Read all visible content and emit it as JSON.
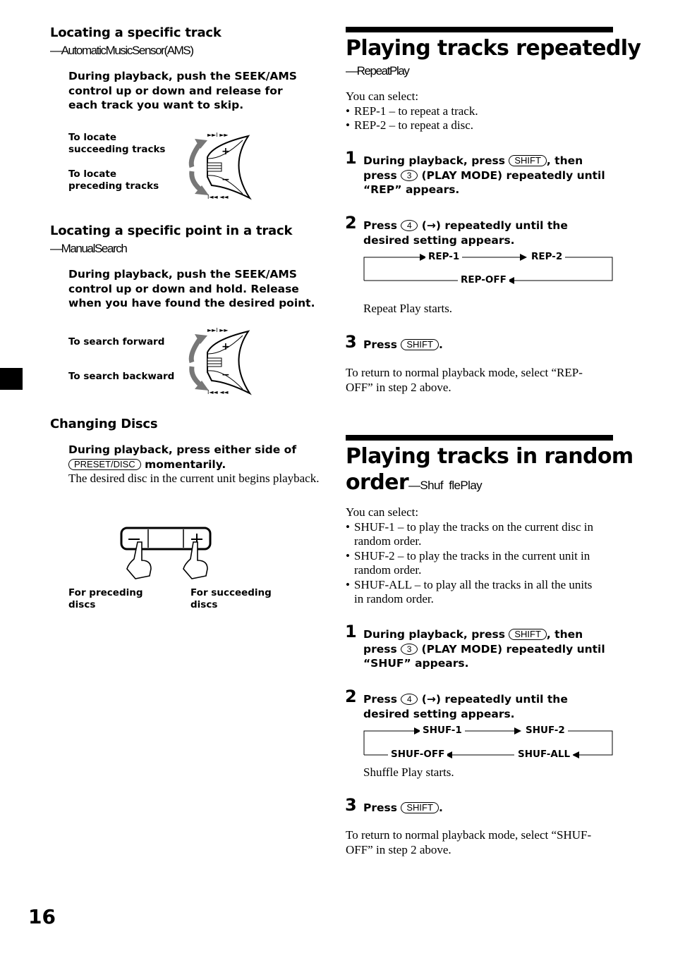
{
  "page_number": "16",
  "left": {
    "ams": {
      "title": "Locating a specific track",
      "subtitle": "—AutomaticMusicSensor(AMS)",
      "instruction": "During playback, push the SEEK/AMS control up or down and release for each track you want to skip.",
      "label_up": "To locate succeeding tracks",
      "label_down": "To locate preceding tracks"
    },
    "manual": {
      "title": "Locating a specific point in a track",
      "subtitle": "—ManualSearch",
      "instruction": "During playback, push the SEEK/AMS control up or down and hold. Release when you have found the desired point.",
      "label_up": "To search forward",
      "label_down": "To search backward"
    },
    "discs": {
      "title": "Changing Discs",
      "instruction_pre": "During playback, press either side of",
      "key": "PRESET/DISC",
      "instruction_post": "momentarily.",
      "body": "The desired disc in the current unit begins playback.",
      "label_left": "For preceding discs",
      "label_right": "For succeeding discs",
      "minus": "−",
      "plus": "+"
    },
    "dial": {
      "plus": "+",
      "minus": "−",
      "top_icons": "►►I ►►",
      "bottom_icons": "I◄◄ ◄◄"
    }
  },
  "repeat": {
    "title": "Playing tracks repeatedly",
    "subtitle": "—RepeatPlay",
    "intro": "You can select:",
    "options": [
      "REP-1 – to repeat a track.",
      "REP-2 – to repeat a disc."
    ],
    "steps": [
      {
        "num": "1",
        "t1": "During playback, press",
        "k1": "SHIFT",
        "t2": ", then press",
        "k2": "3",
        "t3": "(PLAY MODE) repeatedly until “REP” appears."
      },
      {
        "num": "2",
        "t1": "Press",
        "k1": "4",
        "t2": "(→) repeatedly until the desired setting appears."
      },
      {
        "num": "3",
        "t1": "Press",
        "k1": "SHIFT",
        "t2": "."
      }
    ],
    "flow": [
      "REP-1",
      "REP-2",
      "REP-OFF"
    ],
    "after_flow": "Repeat Play starts.",
    "footer": "To return to normal playback mode, select “REP-OFF” in step 2 above."
  },
  "shuffle": {
    "title_line1": "Playing tracks in random",
    "title_line2": "order",
    "subtitle": "—Shuf  flePlay",
    "intro": "You can select:",
    "options": [
      "SHUF-1 – to play the tracks on the current disc in random order.",
      "SHUF-2 – to play the tracks in the current unit in random order.",
      "SHUF-ALL – to play all the tracks in all the units in random order."
    ],
    "steps": [
      {
        "num": "1",
        "t1": "During playback, press",
        "k1": "SHIFT",
        "t2": ", then press",
        "k2": "3",
        "t3": "(PLAY MODE) repeatedly until “SHUF” appears."
      },
      {
        "num": "2",
        "t1": "Press",
        "k1": "4",
        "t2": "(→) repeatedly until the desired setting appears."
      },
      {
        "num": "3",
        "t1": "Press",
        "k1": "SHIFT",
        "t2": "."
      }
    ],
    "flow": [
      "SHUF-1",
      "SHUF-2",
      "SHUF-ALL",
      "SHUF-OFF"
    ],
    "after_flow": "Shuffle Play starts.",
    "footer": "To return to normal playback mode, select “SHUF-OFF” in step 2 above."
  }
}
